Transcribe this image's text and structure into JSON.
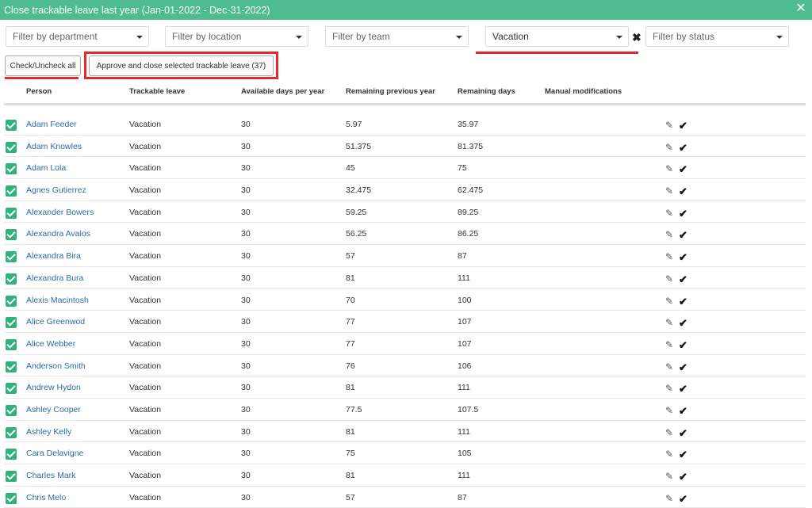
{
  "dialog": {
    "title": "Close trackable leave last year (Jan-01-2022 - Dec-31-2022)",
    "close_icon": "close-icon"
  },
  "filters": {
    "department": "Filter by department",
    "location": "Filter by location",
    "team": "Filter by team",
    "leave_type": "Vacation",
    "status": "Filter by status"
  },
  "buttons": {
    "check_all": "Check/Uncheck all",
    "approve": "Approve and close selected trackable leave (37)"
  },
  "table": {
    "headers": [
      "Person",
      "Trackable leave",
      "Available days per year",
      "Remaining previous year",
      "Remaining days",
      "Manual modifications"
    ],
    "rows": [
      {
        "person": "Adam Feeder",
        "leave": "Vacation",
        "available": "30",
        "prev": "5.97",
        "remaining": "35.97"
      },
      {
        "person": "Adam Knowles",
        "leave": "Vacation",
        "available": "30",
        "prev": "51.375",
        "remaining": "81.375"
      },
      {
        "person": "Adam Lola",
        "leave": "Vacation",
        "available": "30",
        "prev": "45",
        "remaining": "75"
      },
      {
        "person": "Agnes Gutierrez",
        "leave": "Vacation",
        "available": "30",
        "prev": "32.475",
        "remaining": "62.475"
      },
      {
        "person": "Alexander Bowers",
        "leave": "Vacation",
        "available": "30",
        "prev": "59.25",
        "remaining": "89.25"
      },
      {
        "person": "Alexandra Avalos",
        "leave": "Vacation",
        "available": "30",
        "prev": "56.25",
        "remaining": "86.25"
      },
      {
        "person": "Alexandra Bira",
        "leave": "Vacation",
        "available": "30",
        "prev": "57",
        "remaining": "87"
      },
      {
        "person": "Alexandra Bura",
        "leave": "Vacation",
        "available": "30",
        "prev": "81",
        "remaining": "111"
      },
      {
        "person": "Alexis Macintosh",
        "leave": "Vacation",
        "available": "30",
        "prev": "70",
        "remaining": "100"
      },
      {
        "person": "Alice Greenwod",
        "leave": "Vacation",
        "available": "30",
        "prev": "77",
        "remaining": "107"
      },
      {
        "person": "Alice Webber",
        "leave": "Vacation",
        "available": "30",
        "prev": "77",
        "remaining": "107"
      },
      {
        "person": "Anderson Smith",
        "leave": "Vacation",
        "available": "30",
        "prev": "76",
        "remaining": "106"
      },
      {
        "person": "Andrew Hydon",
        "leave": "Vacation",
        "available": "30",
        "prev": "81",
        "remaining": "111"
      },
      {
        "person": "Ashley Cooper",
        "leave": "Vacation",
        "available": "30",
        "prev": "77.5",
        "remaining": "107.5"
      },
      {
        "person": "Ashley Kelly",
        "leave": "Vacation",
        "available": "30",
        "prev": "81",
        "remaining": "111"
      },
      {
        "person": "Cara Delavigne",
        "leave": "Vacation",
        "available": "30",
        "prev": "75",
        "remaining": "105"
      },
      {
        "person": "Charles Mark",
        "leave": "Vacation",
        "available": "30",
        "prev": "81",
        "remaining": "111"
      },
      {
        "person": "Chris Melo",
        "leave": "Vacation",
        "available": "30",
        "prev": "57",
        "remaining": "87"
      }
    ]
  },
  "colors": {
    "accent": "#4ebc8f",
    "checkbox": "#2fb37a",
    "highlight": "#e32b2b",
    "link": "#2c6ca3"
  }
}
